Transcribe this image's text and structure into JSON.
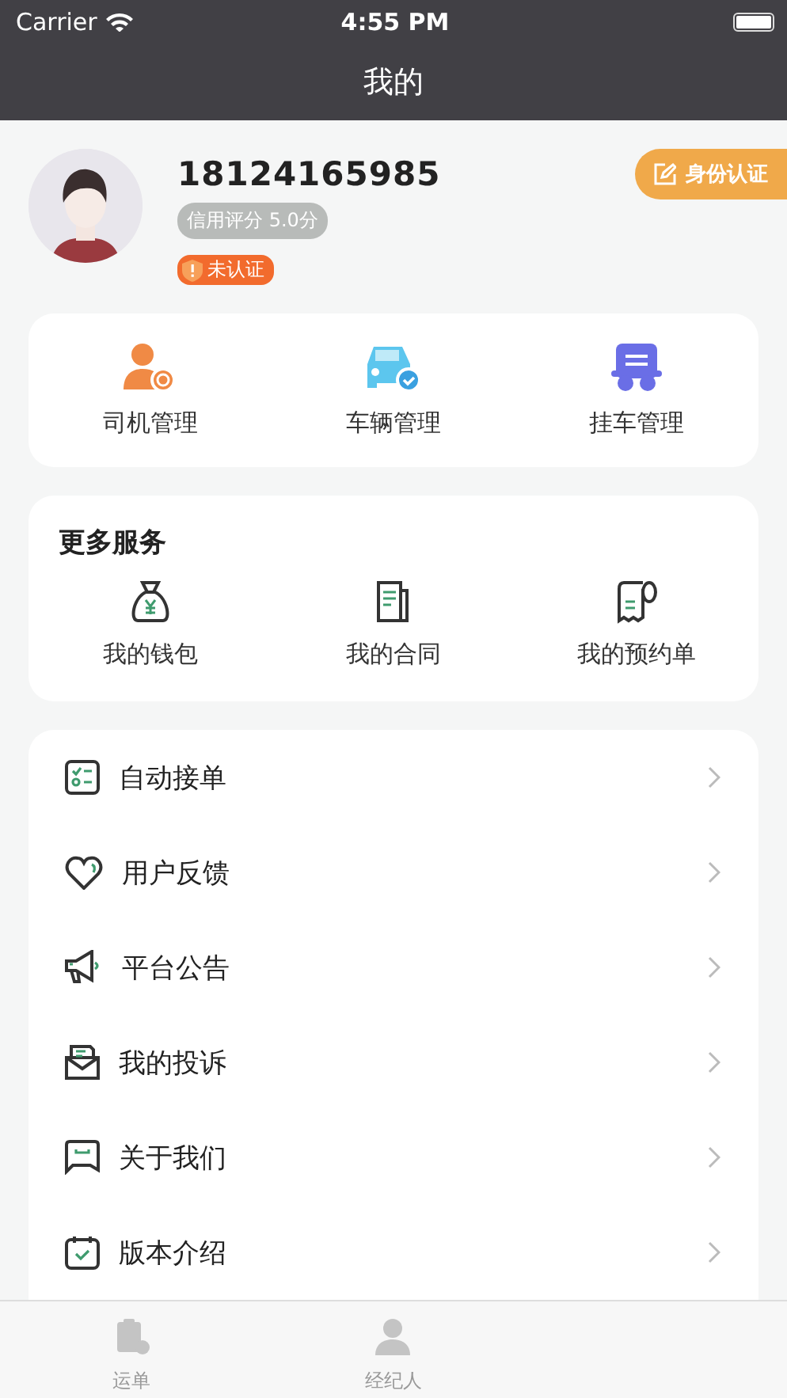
{
  "status_bar": {
    "carrier": "Carrier",
    "time": "4:55 PM"
  },
  "nav": {
    "title": "我的"
  },
  "profile": {
    "phone": "18124165985",
    "credit": "信用评分 5.0分",
    "verify_status": "未认证",
    "verify_button": "身份认证"
  },
  "management": [
    {
      "kind": "driver",
      "label": "司机管理"
    },
    {
      "kind": "car",
      "label": "车辆管理"
    },
    {
      "kind": "trailer",
      "label": "挂车管理"
    }
  ],
  "services": {
    "title": "更多服务",
    "items": [
      {
        "kind": "wallet",
        "label": "我的钱包"
      },
      {
        "kind": "contract",
        "label": "我的合同"
      },
      {
        "kind": "receipt",
        "label": "我的预约单"
      }
    ]
  },
  "menu": [
    {
      "kind": "checklist",
      "label": "自动接单"
    },
    {
      "kind": "heart",
      "label": "用户反馈"
    },
    {
      "kind": "megaphone",
      "label": "平台公告"
    },
    {
      "kind": "mail",
      "label": "我的投诉"
    },
    {
      "kind": "chat",
      "label": "关于我们"
    },
    {
      "kind": "calendar",
      "label": "版本介绍"
    }
  ],
  "tab_bar": [
    {
      "kind": "orders",
      "label": "运单",
      "selected": false
    },
    {
      "kind": "agent",
      "label": "经纪人",
      "selected": false
    }
  ]
}
